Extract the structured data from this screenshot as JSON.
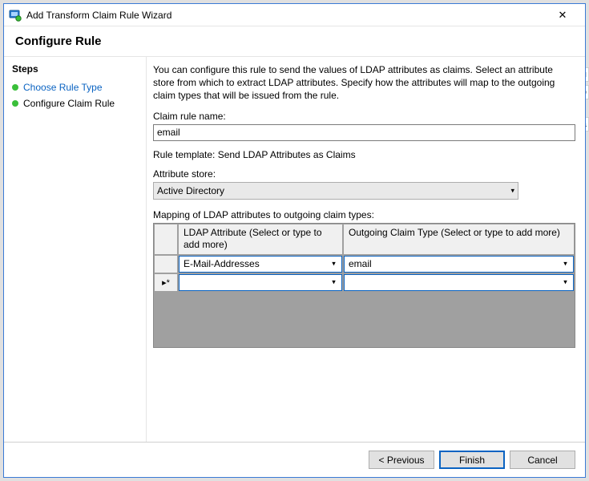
{
  "window": {
    "title": "Add Transform Claim Rule Wizard",
    "close": "✕"
  },
  "header": {
    "title": "Configure Rule"
  },
  "sidebar": {
    "heading": "Steps",
    "items": [
      {
        "label": "Choose Rule Type"
      },
      {
        "label": "Configure Claim Rule"
      }
    ]
  },
  "main": {
    "description": "You can configure this rule to send the values of LDAP attributes as claims. Select an attribute store from which to extract LDAP attributes. Specify how the attributes will map to the outgoing claim types that will be issued from the rule.",
    "claim_rule_name_label": "Claim rule name:",
    "claim_rule_name_value": "email",
    "rule_template_text": "Rule template: Send LDAP Attributes as Claims",
    "attr_store_label": "Attribute store:",
    "attr_store_value": "Active Directory",
    "mapping_label": "Mapping of LDAP attributes to outgoing claim types:",
    "grid": {
      "col1": "LDAP Attribute (Select or type to add more)",
      "col2": "Outgoing Claim Type (Select or type to add more)",
      "rows": [
        {
          "marker": "",
          "ldap": "E-Mail-Addresses",
          "claim": "email"
        },
        {
          "marker": "▸*",
          "ldap": "",
          "claim": ""
        }
      ]
    }
  },
  "footer": {
    "previous": "< Previous",
    "finish": "Finish",
    "cancel": "Cancel"
  },
  "background": {
    "frag1": "Ru",
    "frag2": "t to",
    "frag3": "Cla"
  }
}
